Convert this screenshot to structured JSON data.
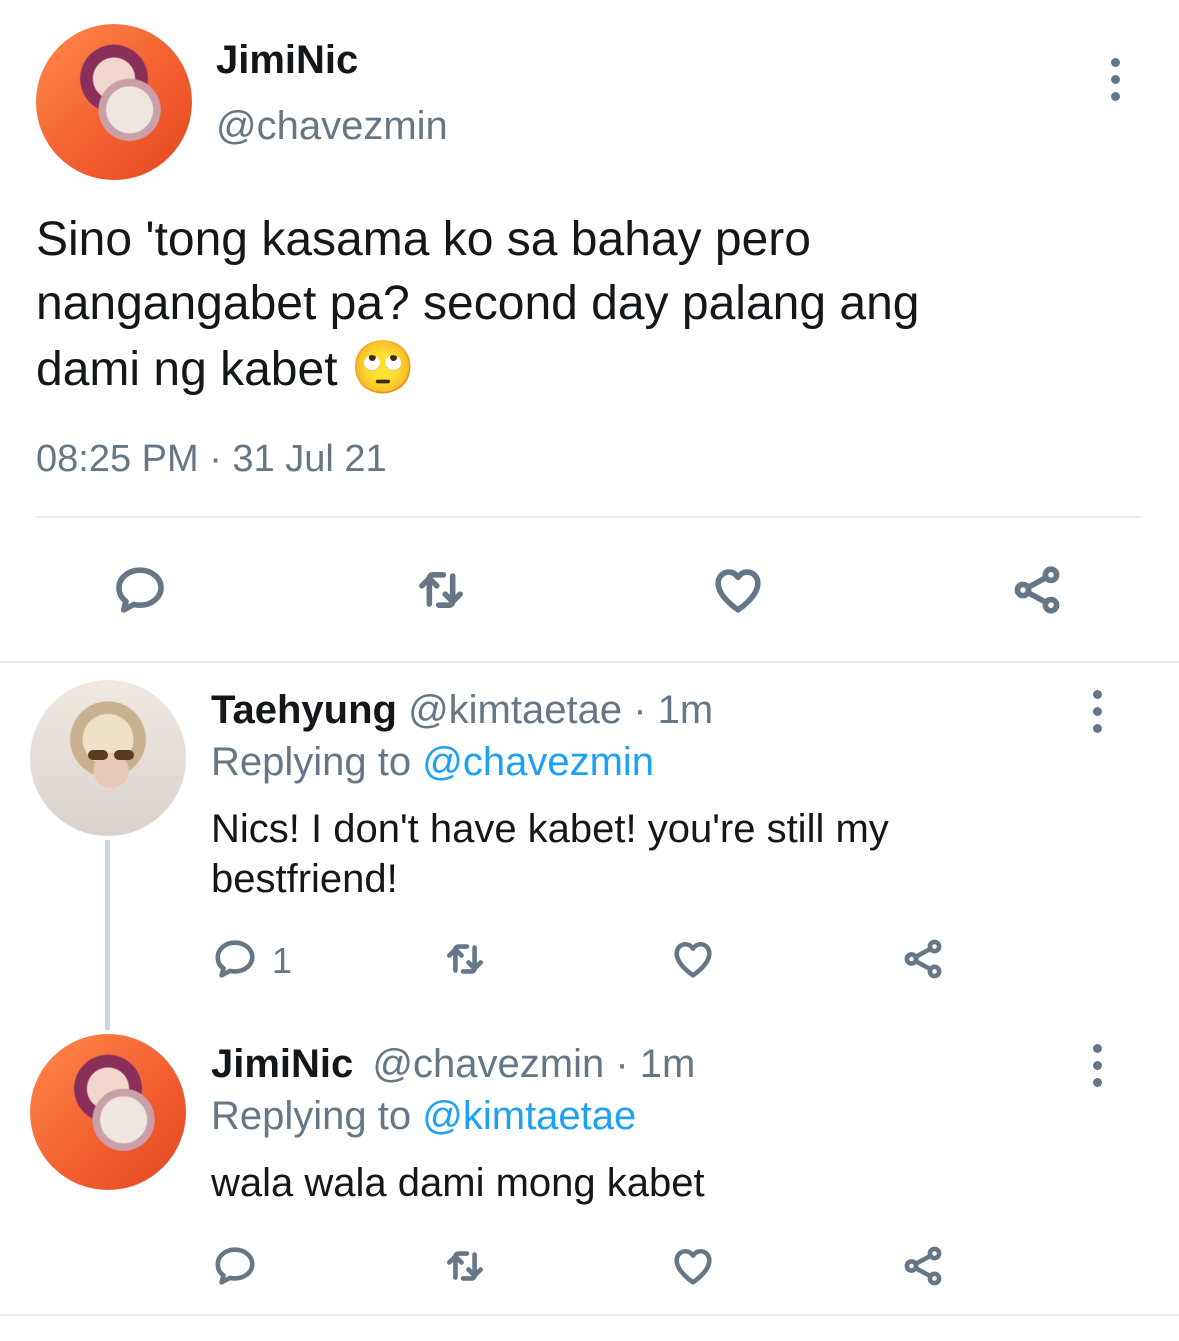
{
  "main_tweet": {
    "display_name": "JimiNic",
    "handle": "@chavezmin",
    "text_lines": [
      "Sino 'tong kasama ko sa bahay pero",
      "nangangabet pa? second day palang ang",
      "dami ng kabet"
    ],
    "emoji": "🙄",
    "timestamp": "08:25 PM · 31 Jul 21"
  },
  "replies": [
    {
      "display_name": "Taehyung",
      "handle_time": "@kimtaetae · 1m",
      "replying_label": "Replying to",
      "replying_to": "@chavezmin",
      "text_lines": [
        "Nics! I don't have kabet! you're still my",
        "bestfriend!"
      ],
      "reply_count": "1"
    },
    {
      "display_name": "JimiNic",
      "handle_time": "@chavezmin · 1m",
      "replying_label": "Replying to",
      "replying_to": "@kimtaetae",
      "text_lines": [
        "wala wala dami mong kabet"
      ],
      "reply_count": ""
    }
  ],
  "icons": [
    "reply-icon",
    "retweet-icon",
    "like-icon",
    "share-icon",
    "more-icon"
  ],
  "colors": {
    "text": "#14171a",
    "muted": "#657786",
    "link": "#1da1f2",
    "divider": "#e6ecf0"
  }
}
